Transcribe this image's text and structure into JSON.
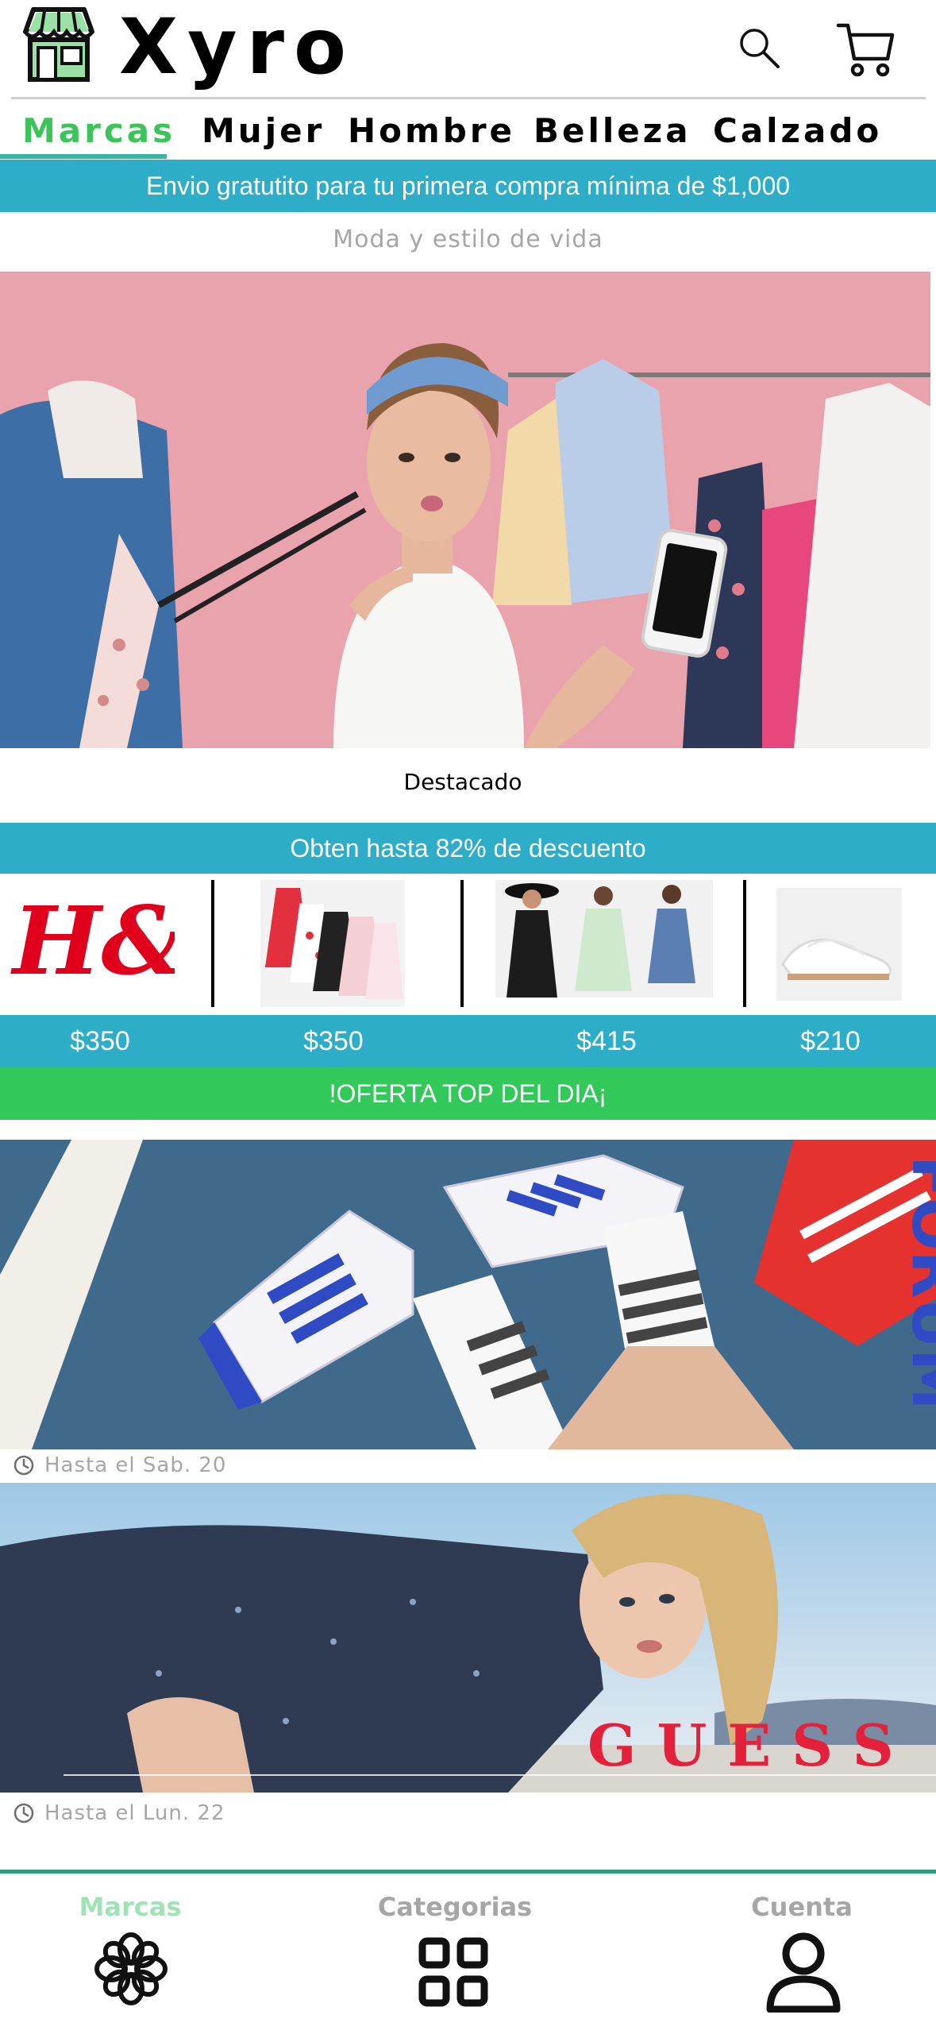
{
  "app": {
    "brand": "Xyro",
    "icons": {
      "logo": "storefront-icon",
      "search": "search-icon",
      "cart": "cart-icon"
    }
  },
  "nav": {
    "tabs": [
      {
        "label": "Marcas",
        "active": true
      },
      {
        "label": "Mujer",
        "active": false
      },
      {
        "label": "Hombre",
        "active": false
      },
      {
        "label": "Belleza",
        "active": false
      },
      {
        "label": "Calzado",
        "active": false
      }
    ]
  },
  "banners": {
    "shipping": "Envio gratutito para tu primera compra mínima de $1,000",
    "tagline": "Moda y estilo de vida",
    "featured": "Destacado",
    "discount": "Obten hasta 82% de descuento",
    "deal_of_day": "!OFERTA TOP DEL DIA¡"
  },
  "products": [
    {
      "name": "H&M",
      "price": "$350"
    },
    {
      "price": "$350"
    },
    {
      "price": "$415"
    },
    {
      "price": "$210"
    }
  ],
  "deals": [
    {
      "brand_text": "FORUM",
      "until": "Hasta el Sab. 20"
    },
    {
      "brand_text": "GUESS",
      "until": "Hasta el Lun. 22"
    }
  ],
  "bottom_nav": {
    "items": [
      {
        "label": "Marcas",
        "icon": "flower-icon",
        "active": true
      },
      {
        "label": "Categorias",
        "icon": "grid-icon",
        "active": false
      },
      {
        "label": "Cuenta",
        "icon": "user-icon",
        "active": false
      }
    ]
  },
  "colors": {
    "accent_green": "#3cc35a",
    "teal": "#2eadc8",
    "deal_green": "#33c95a",
    "divider_green": "#2f9e78",
    "hm_red": "#e0001b"
  }
}
